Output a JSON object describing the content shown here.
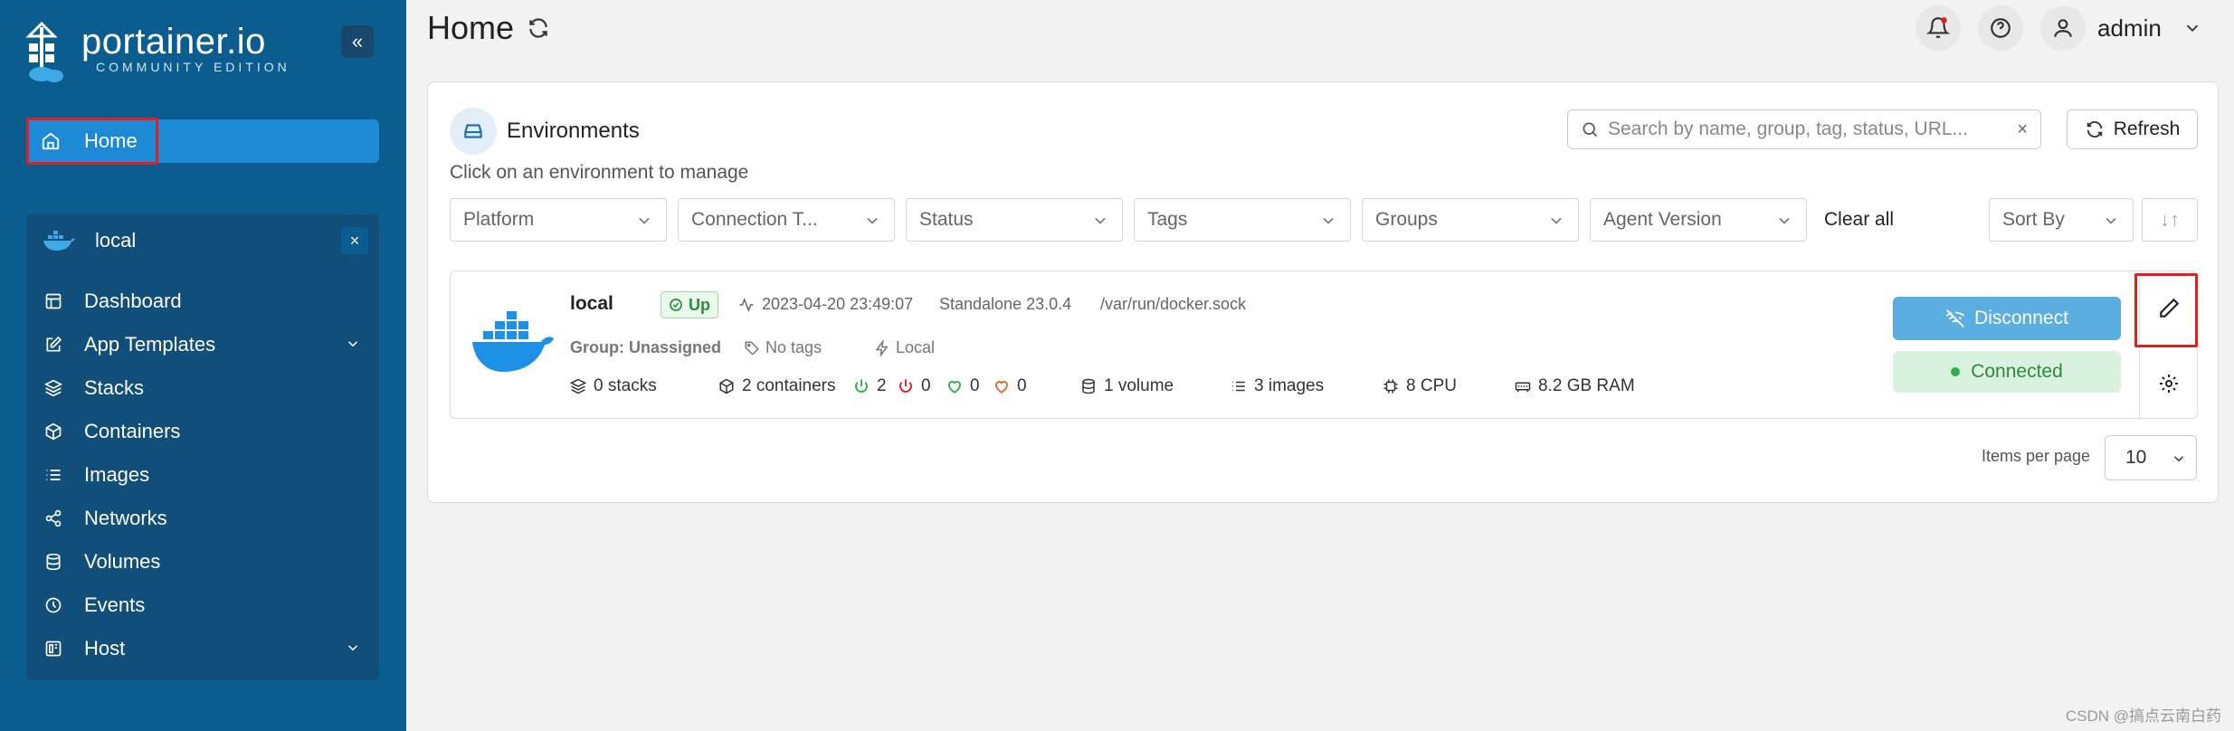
{
  "sidebar": {
    "brand": "portainer.io",
    "edition": "COMMUNITY EDITION",
    "collapse_icon": "«",
    "home_label": "Home",
    "environment": {
      "name": "local",
      "close_icon": "×",
      "items": [
        {
          "label": "Dashboard",
          "icon": "dashboard-icon"
        },
        {
          "label": "App Templates",
          "icon": "edit-icon",
          "expandable": true
        },
        {
          "label": "Stacks",
          "icon": "layers-icon"
        },
        {
          "label": "Containers",
          "icon": "box-icon"
        },
        {
          "label": "Images",
          "icon": "list-icon"
        },
        {
          "label": "Networks",
          "icon": "share-icon"
        },
        {
          "label": "Volumes",
          "icon": "database-icon"
        },
        {
          "label": "Events",
          "icon": "clock-icon"
        },
        {
          "label": "Host",
          "icon": "host-icon",
          "expandable": true
        }
      ]
    }
  },
  "header": {
    "title": "Home",
    "user": "admin"
  },
  "environments": {
    "title": "Environments",
    "subtitle": "Click on an environment to manage",
    "search_placeholder": "Search by name, group, tag, status, URL...",
    "search_clear": "×",
    "refresh_label": "Refresh",
    "filters": [
      "Platform",
      "Connection T...",
      "Status",
      "Tags",
      "Groups",
      "Agent Version"
    ],
    "clear_all": "Clear all",
    "sort_label": "Sort By",
    "sort_toggle": "↓↑",
    "items_per_page_label": "Items per page",
    "items_per_page": "10"
  },
  "env": {
    "name": "local",
    "status": "Up",
    "timestamp": "2023-04-20 23:49:07",
    "type": "Standalone 23.0.4",
    "url": "/var/run/docker.sock",
    "group": "Group: Unassigned",
    "tags": "No tags",
    "local": "Local",
    "stacks": "0 stacks",
    "containers": "2 containers",
    "running": "2",
    "stopped": "0",
    "healthy": "0",
    "unhealthy": "0",
    "volumes": "1 volume",
    "images": "3 images",
    "cpu": "8 CPU",
    "ram": "8.2 GB RAM",
    "disconnect_label": "Disconnect",
    "connected_label": "Connected"
  },
  "watermark": "CSDN @搞点云南白药",
  "colors": {
    "sidebar_bg": "#0b5d8f",
    "active_item": "#1e8ad6",
    "highlight": "#e02020",
    "connected_green": "#2f8a3e",
    "disconnect_blue": "#5aaee0"
  }
}
